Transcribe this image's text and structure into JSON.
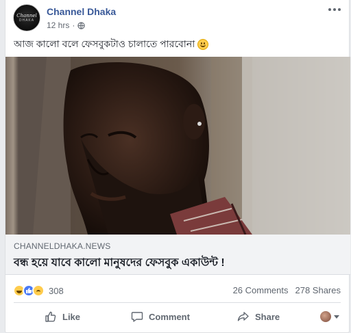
{
  "post": {
    "page_name": "Channel Dhaka",
    "time": "12 hrs",
    "separator": "·",
    "status_text": "আজ কালো বলে ফেসবুকটাও চালাতে পারবোনা",
    "avatar_line1": "Channel",
    "avatar_line2": "DHAKA"
  },
  "link_preview": {
    "domain": "CHANNELDHAKA.NEWS",
    "headline": "বন্ধ হয়ে যাবে কালো মানুষদের ফেসবুক একাউন্ট !"
  },
  "stats": {
    "reaction_count": "308",
    "comments": "26 Comments",
    "shares": "278 Shares",
    "reactions": [
      "haha",
      "like",
      "sad"
    ]
  },
  "actions": {
    "like": "Like",
    "comment": "Comment",
    "share": "Share"
  },
  "icons": {
    "more": "more-horizontal-icon",
    "privacy": "globe-icon",
    "like": "thumbs-up-icon",
    "comment": "speech-bubble-icon",
    "share": "share-arrow-icon"
  },
  "colors": {
    "link_blue": "#385898",
    "muted": "#606770",
    "preview_bg": "#f2f3f5"
  }
}
